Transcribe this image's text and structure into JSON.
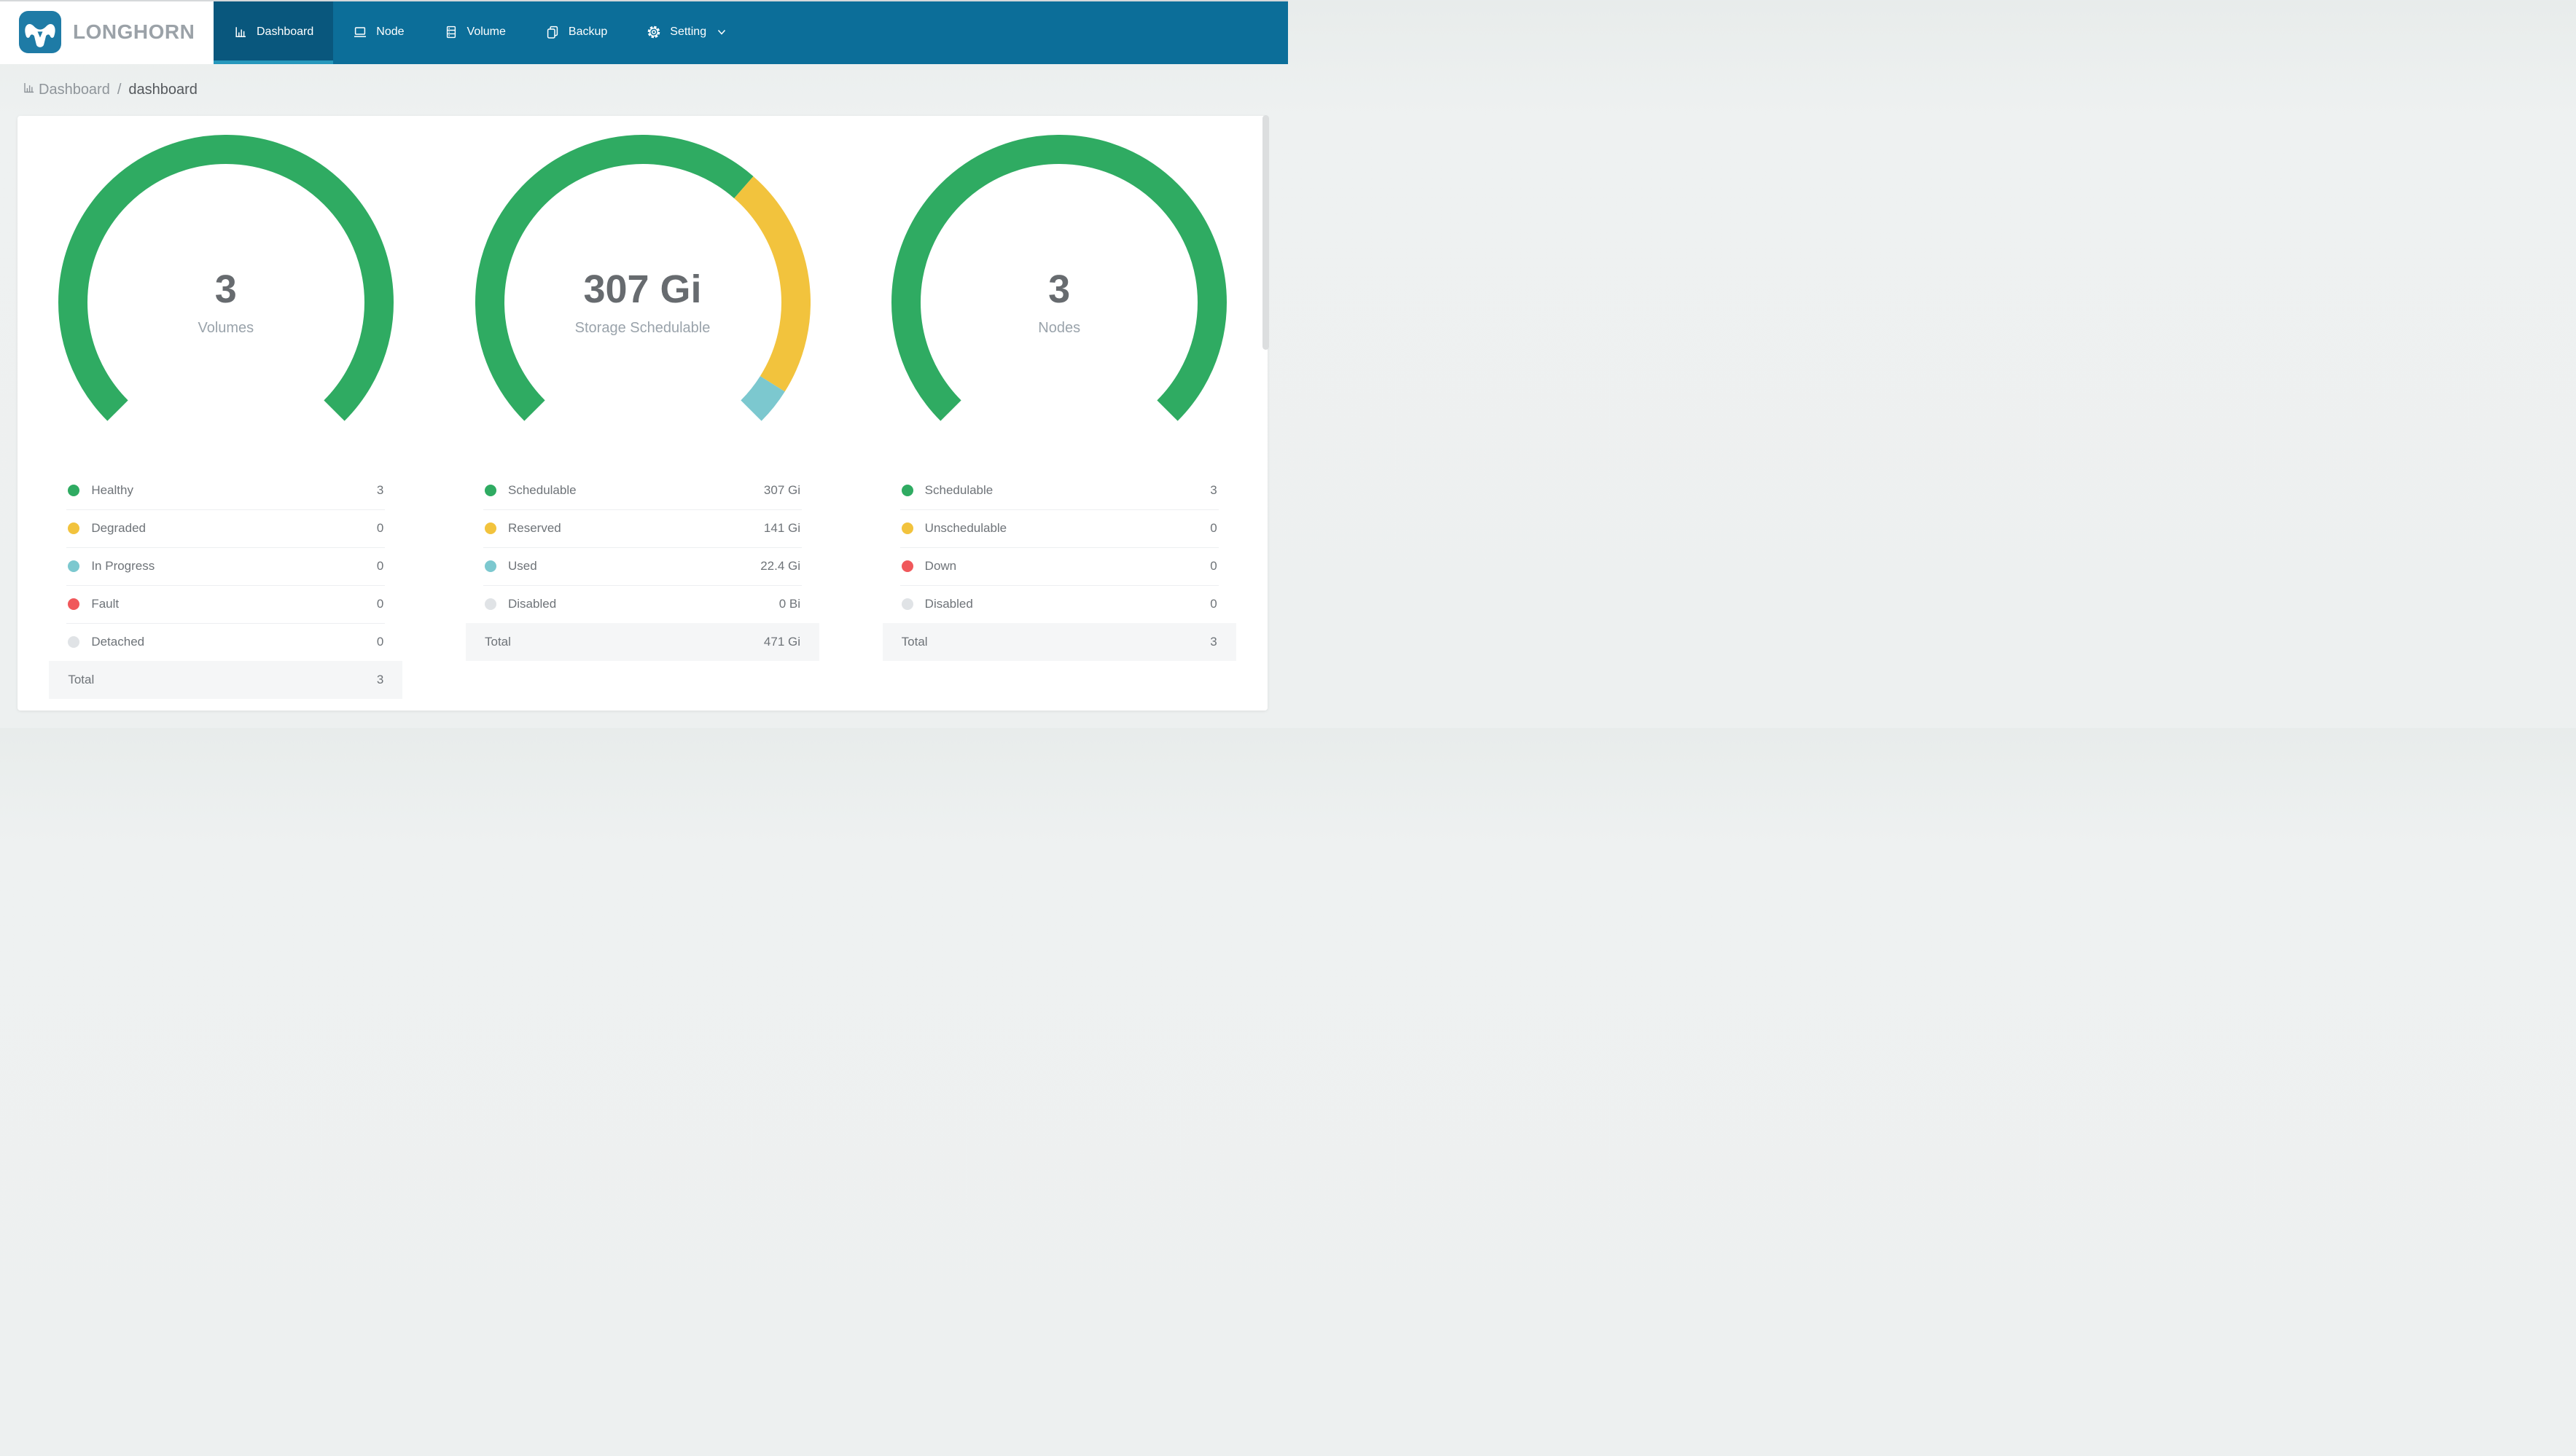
{
  "nav": {
    "brand": "LONGHORN",
    "items": [
      {
        "label": "Dashboard",
        "icon": "dashboard-icon",
        "active": true,
        "has_chevron": false
      },
      {
        "label": "Node",
        "icon": "node-icon",
        "active": false,
        "has_chevron": false
      },
      {
        "label": "Volume",
        "icon": "volume-icon",
        "active": false,
        "has_chevron": false
      },
      {
        "label": "Backup",
        "icon": "backup-icon",
        "active": false,
        "has_chevron": false
      },
      {
        "label": "Setting",
        "icon": "setting-icon",
        "active": false,
        "has_chevron": true
      }
    ]
  },
  "breadcrumb": {
    "icon": "bar-chart-icon",
    "root": "Dashboard",
    "separator": "/",
    "current": "dashboard"
  },
  "colors": {
    "nav_bg": "#0c6e99",
    "nav_active_bg": "#09577d",
    "nav_active_underline": "#2798bc",
    "logo_bg": "#1e7ba6",
    "status": {
      "green": "#2fab62",
      "yellow": "#f2c33d",
      "teal": "#7cc8cf",
      "red": "#f0585b",
      "gray": "#e0e3e6"
    }
  },
  "chart_data": [
    {
      "type": "donut-gauge",
      "name": "volumes-gauge",
      "start_angle": 135,
      "sweep": 270,
      "center": {
        "value": "3",
        "label": "Volumes"
      },
      "rows": [
        {
          "label": "Healthy",
          "color": "green",
          "value": 3,
          "display": "3"
        },
        {
          "label": "Degraded",
          "color": "yellow",
          "value": 0,
          "display": "0"
        },
        {
          "label": "In Progress",
          "color": "teal",
          "value": 0,
          "display": "0"
        },
        {
          "label": "Fault",
          "color": "red",
          "value": 0,
          "display": "0"
        },
        {
          "label": "Detached",
          "color": "gray",
          "value": 0,
          "display": "0"
        }
      ],
      "total": {
        "label": "Total",
        "display": "3"
      }
    },
    {
      "type": "donut-gauge",
      "name": "storage-gauge",
      "start_angle": 135,
      "sweep": 270,
      "center": {
        "value": "307 Gi",
        "label": "Storage Schedulable"
      },
      "rows": [
        {
          "label": "Schedulable",
          "color": "green",
          "value": 307,
          "display": "307 Gi"
        },
        {
          "label": "Reserved",
          "color": "yellow",
          "value": 141,
          "display": "141 Gi"
        },
        {
          "label": "Used",
          "color": "teal",
          "value": 22.4,
          "display": "22.4 Gi"
        },
        {
          "label": "Disabled",
          "color": "gray",
          "value": 0,
          "display": "0 Bi"
        }
      ],
      "total": {
        "label": "Total",
        "display": "471 Gi"
      }
    },
    {
      "type": "donut-gauge",
      "name": "nodes-gauge",
      "start_angle": 135,
      "sweep": 270,
      "center": {
        "value": "3",
        "label": "Nodes"
      },
      "rows": [
        {
          "label": "Schedulable",
          "color": "green",
          "value": 3,
          "display": "3"
        },
        {
          "label": "Unschedulable",
          "color": "yellow",
          "value": 0,
          "display": "0"
        },
        {
          "label": "Down",
          "color": "red",
          "value": 0,
          "display": "0"
        },
        {
          "label": "Disabled",
          "color": "gray",
          "value": 0,
          "display": "0"
        }
      ],
      "total": {
        "label": "Total",
        "display": "3"
      }
    }
  ]
}
